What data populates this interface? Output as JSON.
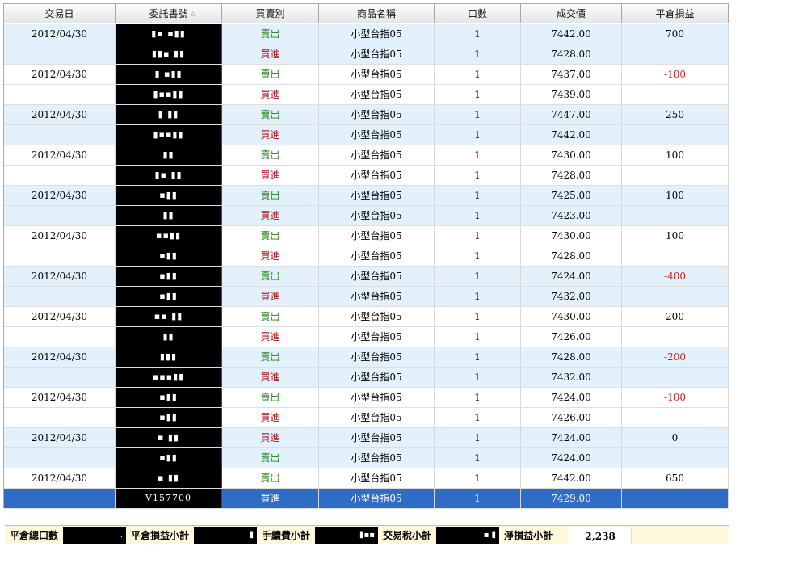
{
  "columns": [
    "交易日",
    "委託書號",
    "買賣別",
    "商品名稱",
    "口數",
    "成交價",
    "平倉損益"
  ],
  "sort_indicator": "△",
  "rows": [
    {
      "date": "2012/04/30",
      "order": "▮▪ ▪▮▮",
      "side": "賣出",
      "side_type": "sell",
      "product": "小型台指05",
      "qty": "1",
      "price": "7442.00",
      "pnl": "700",
      "pnl_neg": false,
      "style": "alt"
    },
    {
      "date": "",
      "order": "▮▮▪ ▮▮",
      "side": "買進",
      "side_type": "buy",
      "product": "小型台指05",
      "qty": "1",
      "price": "7428.00",
      "pnl": "",
      "pnl_neg": false,
      "style": "alt"
    },
    {
      "date": "2012/04/30",
      "order": "▮ ▪▮▮",
      "side": "賣出",
      "side_type": "sell",
      "product": "小型台指05",
      "qty": "1",
      "price": "7437.00",
      "pnl": "-100",
      "pnl_neg": true,
      "style": "plain"
    },
    {
      "date": "",
      "order": "▮▪▪▮▮",
      "side": "買進",
      "side_type": "buy",
      "product": "小型台指05",
      "qty": "1",
      "price": "7439.00",
      "pnl": "",
      "pnl_neg": false,
      "style": "plain"
    },
    {
      "date": "2012/04/30",
      "order": "▮ ▮▮",
      "side": "賣出",
      "side_type": "sell",
      "product": "小型台指05",
      "qty": "1",
      "price": "7447.00",
      "pnl": "250",
      "pnl_neg": false,
      "style": "alt"
    },
    {
      "date": "",
      "order": "▮▪▪▮▮",
      "side": "買進",
      "side_type": "buy",
      "product": "小型台指05",
      "qty": "1",
      "price": "7442.00",
      "pnl": "",
      "pnl_neg": false,
      "style": "alt"
    },
    {
      "date": "2012/04/30",
      "order": "▮▮",
      "side": "賣出",
      "side_type": "sell",
      "product": "小型台指05",
      "qty": "1",
      "price": "7430.00",
      "pnl": "100",
      "pnl_neg": false,
      "style": "plain"
    },
    {
      "date": "",
      "order": "▮▪ ▮▮",
      "side": "買進",
      "side_type": "buy",
      "product": "小型台指05",
      "qty": "1",
      "price": "7428.00",
      "pnl": "",
      "pnl_neg": false,
      "style": "plain"
    },
    {
      "date": "2012/04/30",
      "order": "▪▮▮",
      "side": "賣出",
      "side_type": "sell",
      "product": "小型台指05",
      "qty": "1",
      "price": "7425.00",
      "pnl": "100",
      "pnl_neg": false,
      "style": "alt"
    },
    {
      "date": "",
      "order": "▮▮",
      "side": "買進",
      "side_type": "buy",
      "product": "小型台指05",
      "qty": "1",
      "price": "7423.00",
      "pnl": "",
      "pnl_neg": false,
      "style": "alt"
    },
    {
      "date": "2012/04/30",
      "order": "▪▪▮▮",
      "side": "賣出",
      "side_type": "sell",
      "product": "小型台指05",
      "qty": "1",
      "price": "7430.00",
      "pnl": "100",
      "pnl_neg": false,
      "style": "plain"
    },
    {
      "date": "",
      "order": "▪▮▮",
      "side": "買進",
      "side_type": "buy",
      "product": "小型台指05",
      "qty": "1",
      "price": "7428.00",
      "pnl": "",
      "pnl_neg": false,
      "style": "plain"
    },
    {
      "date": "2012/04/30",
      "order": "▪▮▮",
      "side": "賣出",
      "side_type": "sell",
      "product": "小型台指05",
      "qty": "1",
      "price": "7424.00",
      "pnl": "-400",
      "pnl_neg": true,
      "style": "alt"
    },
    {
      "date": "",
      "order": "▪▮▮",
      "side": "買進",
      "side_type": "buy",
      "product": "小型台指05",
      "qty": "1",
      "price": "7432.00",
      "pnl": "",
      "pnl_neg": false,
      "style": "alt"
    },
    {
      "date": "2012/04/30",
      "order": "▪▪ ▮▮",
      "side": "賣出",
      "side_type": "sell",
      "product": "小型台指05",
      "qty": "1",
      "price": "7430.00",
      "pnl": "200",
      "pnl_neg": false,
      "style": "plain"
    },
    {
      "date": "",
      "order": "▮▮",
      "side": "買進",
      "side_type": "buy",
      "product": "小型台指05",
      "qty": "1",
      "price": "7426.00",
      "pnl": "",
      "pnl_neg": false,
      "style": "plain"
    },
    {
      "date": "2012/04/30",
      "order": "▮▮▮",
      "side": "賣出",
      "side_type": "sell",
      "product": "小型台指05",
      "qty": "1",
      "price": "7428.00",
      "pnl": "-200",
      "pnl_neg": true,
      "style": "alt"
    },
    {
      "date": "",
      "order": "▪▪▪▮▮",
      "side": "買進",
      "side_type": "buy",
      "product": "小型台指05",
      "qty": "1",
      "price": "7432.00",
      "pnl": "",
      "pnl_neg": false,
      "style": "alt"
    },
    {
      "date": "2012/04/30",
      "order": "▪▮▮",
      "side": "賣出",
      "side_type": "sell",
      "product": "小型台指05",
      "qty": "1",
      "price": "7424.00",
      "pnl": "-100",
      "pnl_neg": true,
      "style": "plain"
    },
    {
      "date": "",
      "order": "▪▮▮",
      "side": "買進",
      "side_type": "buy",
      "product": "小型台指05",
      "qty": "1",
      "price": "7426.00",
      "pnl": "",
      "pnl_neg": false,
      "style": "plain"
    },
    {
      "date": "2012/04/30",
      "order": "▪ ▮▮",
      "side": "買進",
      "side_type": "buy",
      "product": "小型台指05",
      "qty": "1",
      "price": "7424.00",
      "pnl": "0",
      "pnl_neg": false,
      "style": "alt"
    },
    {
      "date": "",
      "order": "▪▮▮",
      "side": "賣出",
      "side_type": "sell",
      "product": "小型台指05",
      "qty": "1",
      "price": "7424.00",
      "pnl": "",
      "pnl_neg": false,
      "style": "alt"
    },
    {
      "date": "2012/04/30",
      "order": "▪ ▮▮",
      "side": "賣出",
      "side_type": "sell",
      "product": "小型台指05",
      "qty": "1",
      "price": "7442.00",
      "pnl": "650",
      "pnl_neg": false,
      "style": "plain"
    },
    {
      "date": "",
      "order": "V157700",
      "side": "買進",
      "side_type": "buy",
      "product": "小型台指05",
      "qty": "1",
      "price": "7429.00",
      "pnl": "",
      "pnl_neg": false,
      "style": "selected"
    }
  ],
  "summary": {
    "total_lots_label": "平倉總口數",
    "total_lots_value": ".",
    "pnl_subtotal_label": "平倉損益小計",
    "pnl_subtotal_value": "▮",
    "fee_subtotal_label": "手續費小計",
    "fee_subtotal_value": "▮▪▪",
    "tax_subtotal_label": "交易稅小計",
    "tax_subtotal_value": "▪ ▮",
    "net_pnl_label": "淨損益小計",
    "net_pnl_value": "2,238"
  }
}
